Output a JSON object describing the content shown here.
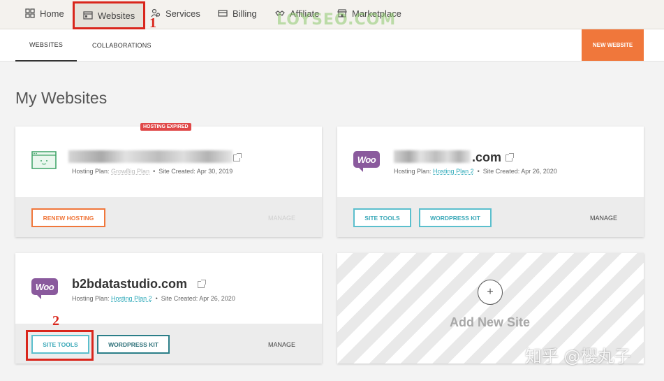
{
  "topnav": {
    "items": [
      {
        "label": "Home",
        "icon": "grid-icon"
      },
      {
        "label": "Websites",
        "icon": "browser-icon"
      },
      {
        "label": "Services",
        "icon": "services-icon"
      },
      {
        "label": "Billing",
        "icon": "card-icon"
      },
      {
        "label": "Affiliate",
        "icon": "handshake-icon"
      },
      {
        "label": "Marketplace",
        "icon": "store-icon"
      }
    ],
    "watermark": "LOYSEO.COM"
  },
  "annotations": {
    "step1": "1",
    "step2": "2"
  },
  "subtabs": {
    "websites": "WEBSITES",
    "collaborations": "COLLABORATIONS",
    "new_website": "NEW WEBSITE"
  },
  "page_title": "My Websites",
  "sites": [
    {
      "badge": "HOSTING EXPIRED",
      "plan_prefix": "Hosting Plan:",
      "plan": "GrowBig Plan",
      "created": "Site Created: Apr 30, 2019",
      "button": "RENEW HOSTING",
      "manage": "MANAGE"
    },
    {
      "name": ".com",
      "logo": "Woo",
      "plan_prefix": "Hosting Plan:",
      "plan": "Hosting Plan 2",
      "created": "Site Created: Apr 26, 2020",
      "button1": "SITE TOOLS",
      "button2": "WORDPRESS KIT",
      "manage": "MANAGE"
    },
    {
      "name": "b2bdatastudio.com",
      "logo": "Woo",
      "plan_prefix": "Hosting Plan:",
      "plan": "Hosting Plan 2",
      "created": "Site Created: Apr 26, 2020",
      "button1": "SITE TOOLS",
      "button2": "WORDPRESS KIT",
      "manage": "MANAGE"
    }
  ],
  "add_site": {
    "label": "Add New Site",
    "plus": "+"
  },
  "bottom_watermark": "知乎 @樱丸子",
  "colors": {
    "accent_orange": "#f0773b",
    "teal": "#3aa8b8",
    "woo_purple": "#8a5a9d",
    "annotation_red": "#d9261c",
    "expired_red": "#e04848"
  }
}
